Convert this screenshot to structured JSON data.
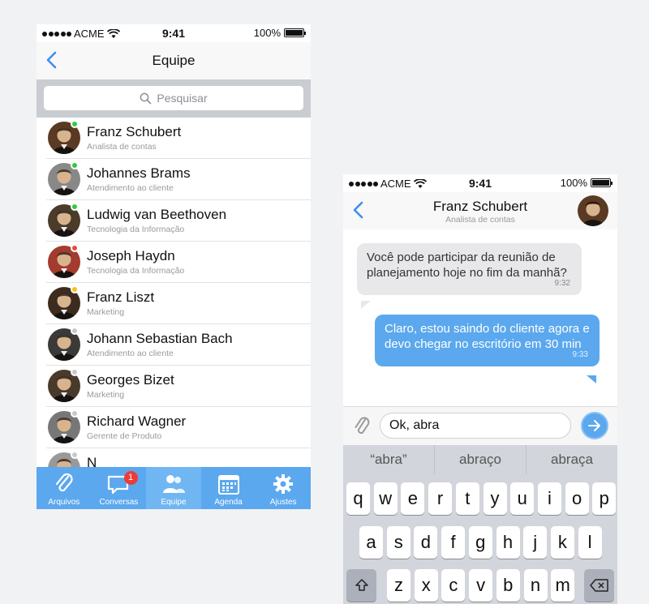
{
  "left_phone": {
    "status": {
      "carrier": "ACME",
      "time": "9:41",
      "battery": "100%"
    },
    "nav": {
      "title": "Equipe"
    },
    "search": {
      "placeholder": "Pesquisar"
    },
    "contacts": [
      {
        "name": "Franz Schubert",
        "role": "Analista de contas",
        "status": "online",
        "status_color": "#2ecc40",
        "avatar_color": "#5a3a22"
      },
      {
        "name": "Johannes Brams",
        "role": "Atendimento ao cliente",
        "status": "online",
        "status_color": "#2ecc40",
        "avatar_color": "#888888"
      },
      {
        "name": "Ludwig van Beethoven",
        "role": "Tecnologia da Informação",
        "status": "online",
        "status_color": "#2ecc40",
        "avatar_color": "#4b3b2b"
      },
      {
        "name": "Joseph Haydn",
        "role": "Tecnologia da Informação",
        "status": "busy",
        "status_color": "#e74c3c",
        "avatar_color": "#a33b2e"
      },
      {
        "name": "Franz Liszt",
        "role": "Marketing",
        "status": "away",
        "status_color": "#f1c40f",
        "avatar_color": "#3d2b1f"
      },
      {
        "name": "Johann Sebastian Bach",
        "role": "Atendimento ao cliente",
        "status": "offline",
        "status_color": "#c8c8c8",
        "avatar_color": "#3b3a38"
      },
      {
        "name": "Georges Bizet",
        "role": "Marketing",
        "status": "offline",
        "status_color": "#c8c8c8",
        "avatar_color": "#4a3a2c"
      },
      {
        "name": "Richard Wagner",
        "role": "Gerente de Produto",
        "status": "offline",
        "status_color": "#c8c8c8",
        "avatar_color": "#777777"
      },
      {
        "name": "N",
        "role": "",
        "status": "offline",
        "status_color": "#c8c8c8",
        "avatar_color": "#999999"
      }
    ],
    "tabs": [
      {
        "label": "Arquivos",
        "icon": "paperclip-icon"
      },
      {
        "label": "Conversas",
        "icon": "chat-bubble-icon",
        "badge": "1"
      },
      {
        "label": "Equipe",
        "icon": "people-icon",
        "active": true
      },
      {
        "label": "Agenda",
        "icon": "calendar-icon"
      },
      {
        "label": "Ajustes",
        "icon": "gear-icon"
      }
    ]
  },
  "right_phone": {
    "status": {
      "carrier": "ACME",
      "time": "9:41",
      "battery": "100%"
    },
    "nav": {
      "title": "Franz Schubert",
      "subtitle": "Analista de contas"
    },
    "messages": [
      {
        "direction": "incoming",
        "text": "Você pode participar da reunião de planejamento hoje no fim da manhã?",
        "time": "9:32"
      },
      {
        "direction": "outgoing",
        "text": "Claro, estou saindo do cliente agora e devo chegar no escritório em 30 min",
        "time": "9:33"
      }
    ],
    "composer": {
      "value": "Ok, abra"
    },
    "keyboard": {
      "suggestions": [
        "“abra”",
        "abraço",
        "abraça"
      ],
      "row1": [
        "q",
        "w",
        "e",
        "r",
        "t",
        "y",
        "u",
        "i",
        "o",
        "p"
      ],
      "row2": [
        "a",
        "s",
        "d",
        "f",
        "g",
        "h",
        "j",
        "k",
        "l"
      ],
      "row3": [
        "z",
        "x",
        "c",
        "v",
        "b",
        "n",
        "m"
      ]
    }
  },
  "colors": {
    "accent": "#5ba8ee",
    "badge": "#ee3b37"
  }
}
